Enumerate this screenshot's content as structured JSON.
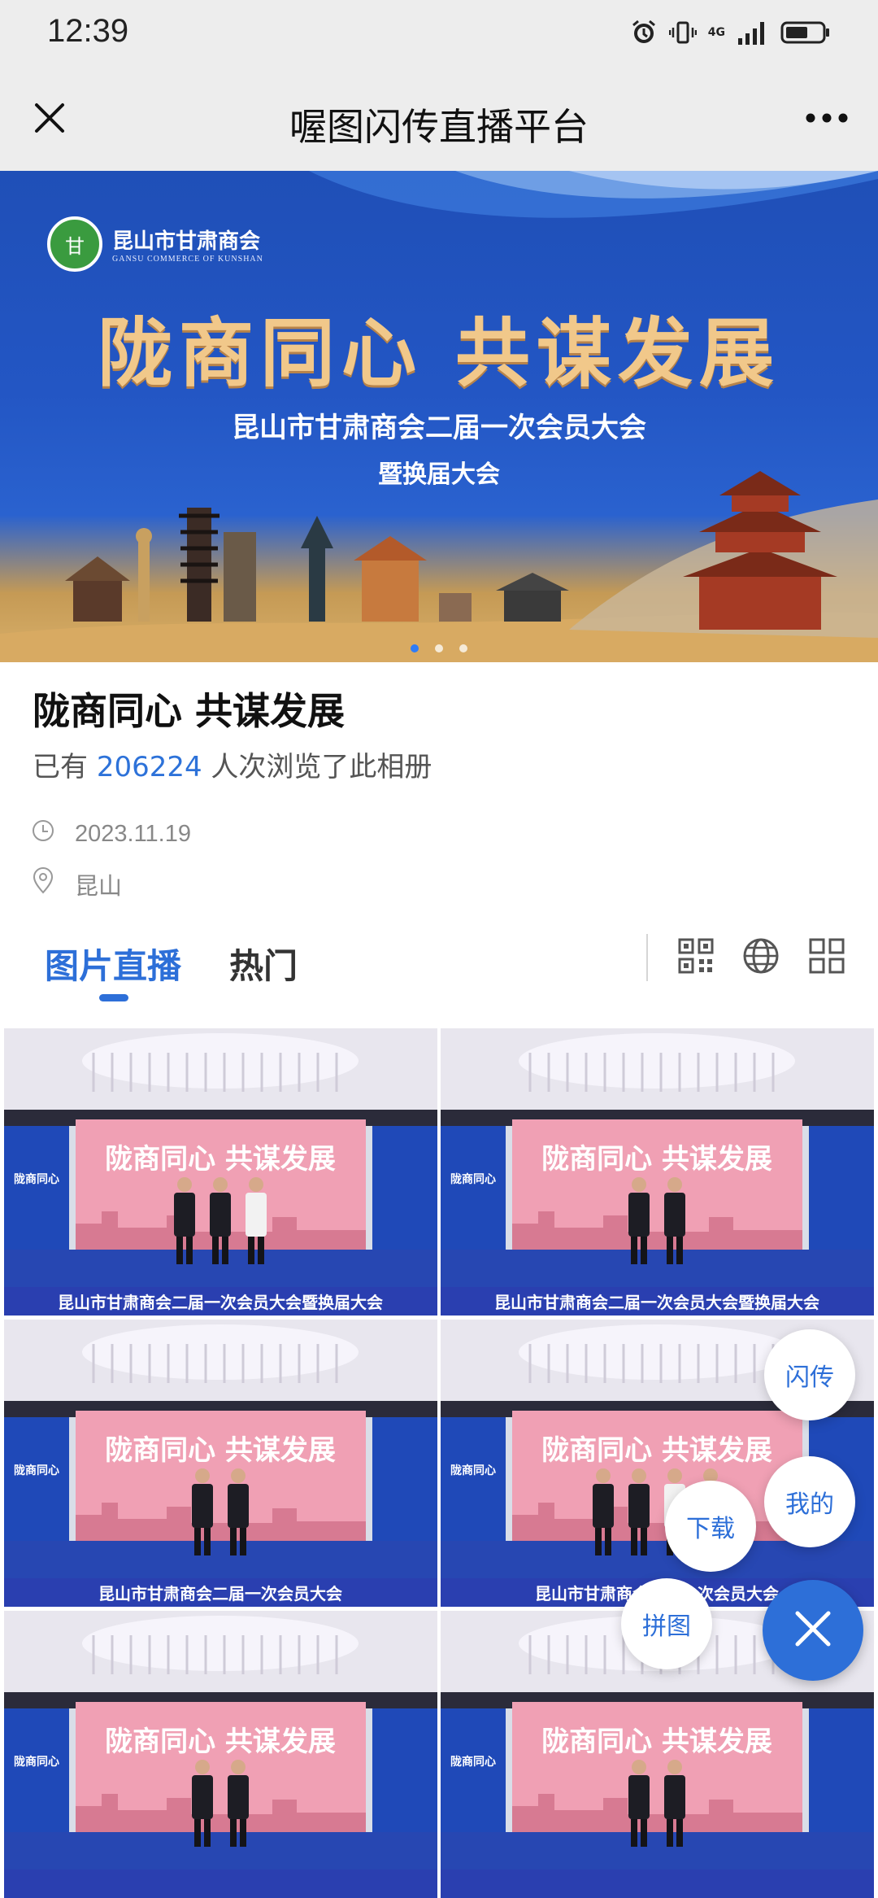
{
  "status_bar": {
    "time": "12:39",
    "network": "4G"
  },
  "nav": {
    "title": "喔图闪传直播平台"
  },
  "banner": {
    "org_name": "昆山市甘肃商会",
    "org_name_en": "GANSU COMMERCE OF KUNSHAN",
    "seal_text": "甘",
    "slogan": "陇商同心 共谋发展",
    "line1": "昆山市甘肃商会二届一次会员大会",
    "line2": "暨换届大会",
    "dots": 3,
    "active_dot": 0
  },
  "album": {
    "title": "陇商同心 共谋发展",
    "views_prefix": "已有",
    "views_count": "206224",
    "views_suffix": "人次浏览了此相册",
    "date": "2023.11.19",
    "location": "昆山"
  },
  "tabs": [
    {
      "label": "图片直播",
      "active": true
    },
    {
      "label": "热门",
      "active": false
    }
  ],
  "photos": [
    {
      "people": 3,
      "footer": "昆山市甘肃商会二届一次会员大会暨换届大会"
    },
    {
      "people": 2,
      "footer": "昆山市甘肃商会二届一次会员大会暨换届大会"
    },
    {
      "people": 2,
      "footer": "昆山市甘肃商会二届一次会员大会"
    },
    {
      "people": 4,
      "footer": "昆山市甘肃商会二届一次会员大会"
    },
    {
      "people": 2,
      "footer": ""
    },
    {
      "people": 2,
      "footer": ""
    }
  ],
  "photo_stage": {
    "slogan": "陇商同心 共谋发展",
    "side_text": "陇商同心 共谋发展"
  },
  "fab": {
    "flash": "闪传",
    "mine": "我的",
    "download": "下载",
    "collage": "拼图"
  },
  "colors": {
    "accent": "#2d6fd8",
    "banner_blue": "#2356c4",
    "gold": "#f1c88a"
  },
  "icons": [
    "close-icon",
    "more-icon",
    "clock-icon",
    "location-pin-icon",
    "qr-code-icon",
    "globe-icon",
    "grid-layout-icon"
  ]
}
